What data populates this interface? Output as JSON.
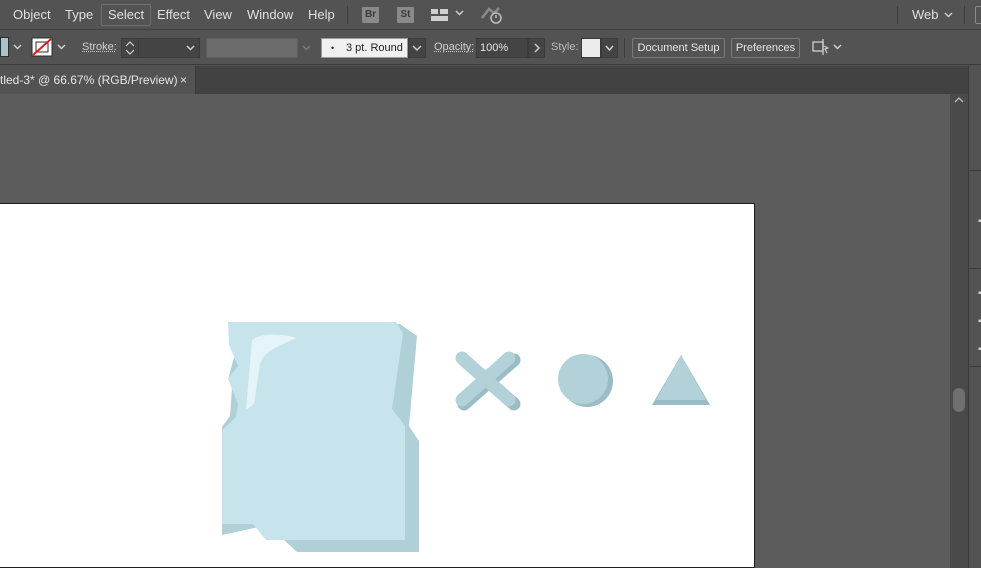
{
  "menu": {
    "items": [
      "Object",
      "Type",
      "Select",
      "Effect",
      "View",
      "Window",
      "Help"
    ],
    "active": "Select",
    "badges": [
      "Br",
      "St"
    ],
    "workspace": "Web"
  },
  "controls": {
    "stroke_label": "Stroke:",
    "brush": "3 pt. Round",
    "opacity_label": "Opacity:",
    "opacity_value": "100%",
    "style_label": "Style:",
    "document_setup": "Document Setup",
    "preferences": "Preferences"
  },
  "tab": {
    "title": "tled-3* @ 66.67% (RGB/Preview)",
    "close": "×"
  },
  "colors": {
    "chrome": "#535353",
    "canvas": "#5c5c5c",
    "artboard": "#ffffff",
    "shape_light": "#c7e4ec",
    "shape_shadow": "#b0d0d8",
    "shape_highlight": "#e4f4f8"
  },
  "icons": [
    "arrange-documents-icon",
    "gpu-performance-icon",
    "stroke-swatch-icon",
    "stepper-icon",
    "align-icon"
  ],
  "artwork": [
    "cube-illustration",
    "cross-shape",
    "circle-shape",
    "triangle-shape"
  ]
}
